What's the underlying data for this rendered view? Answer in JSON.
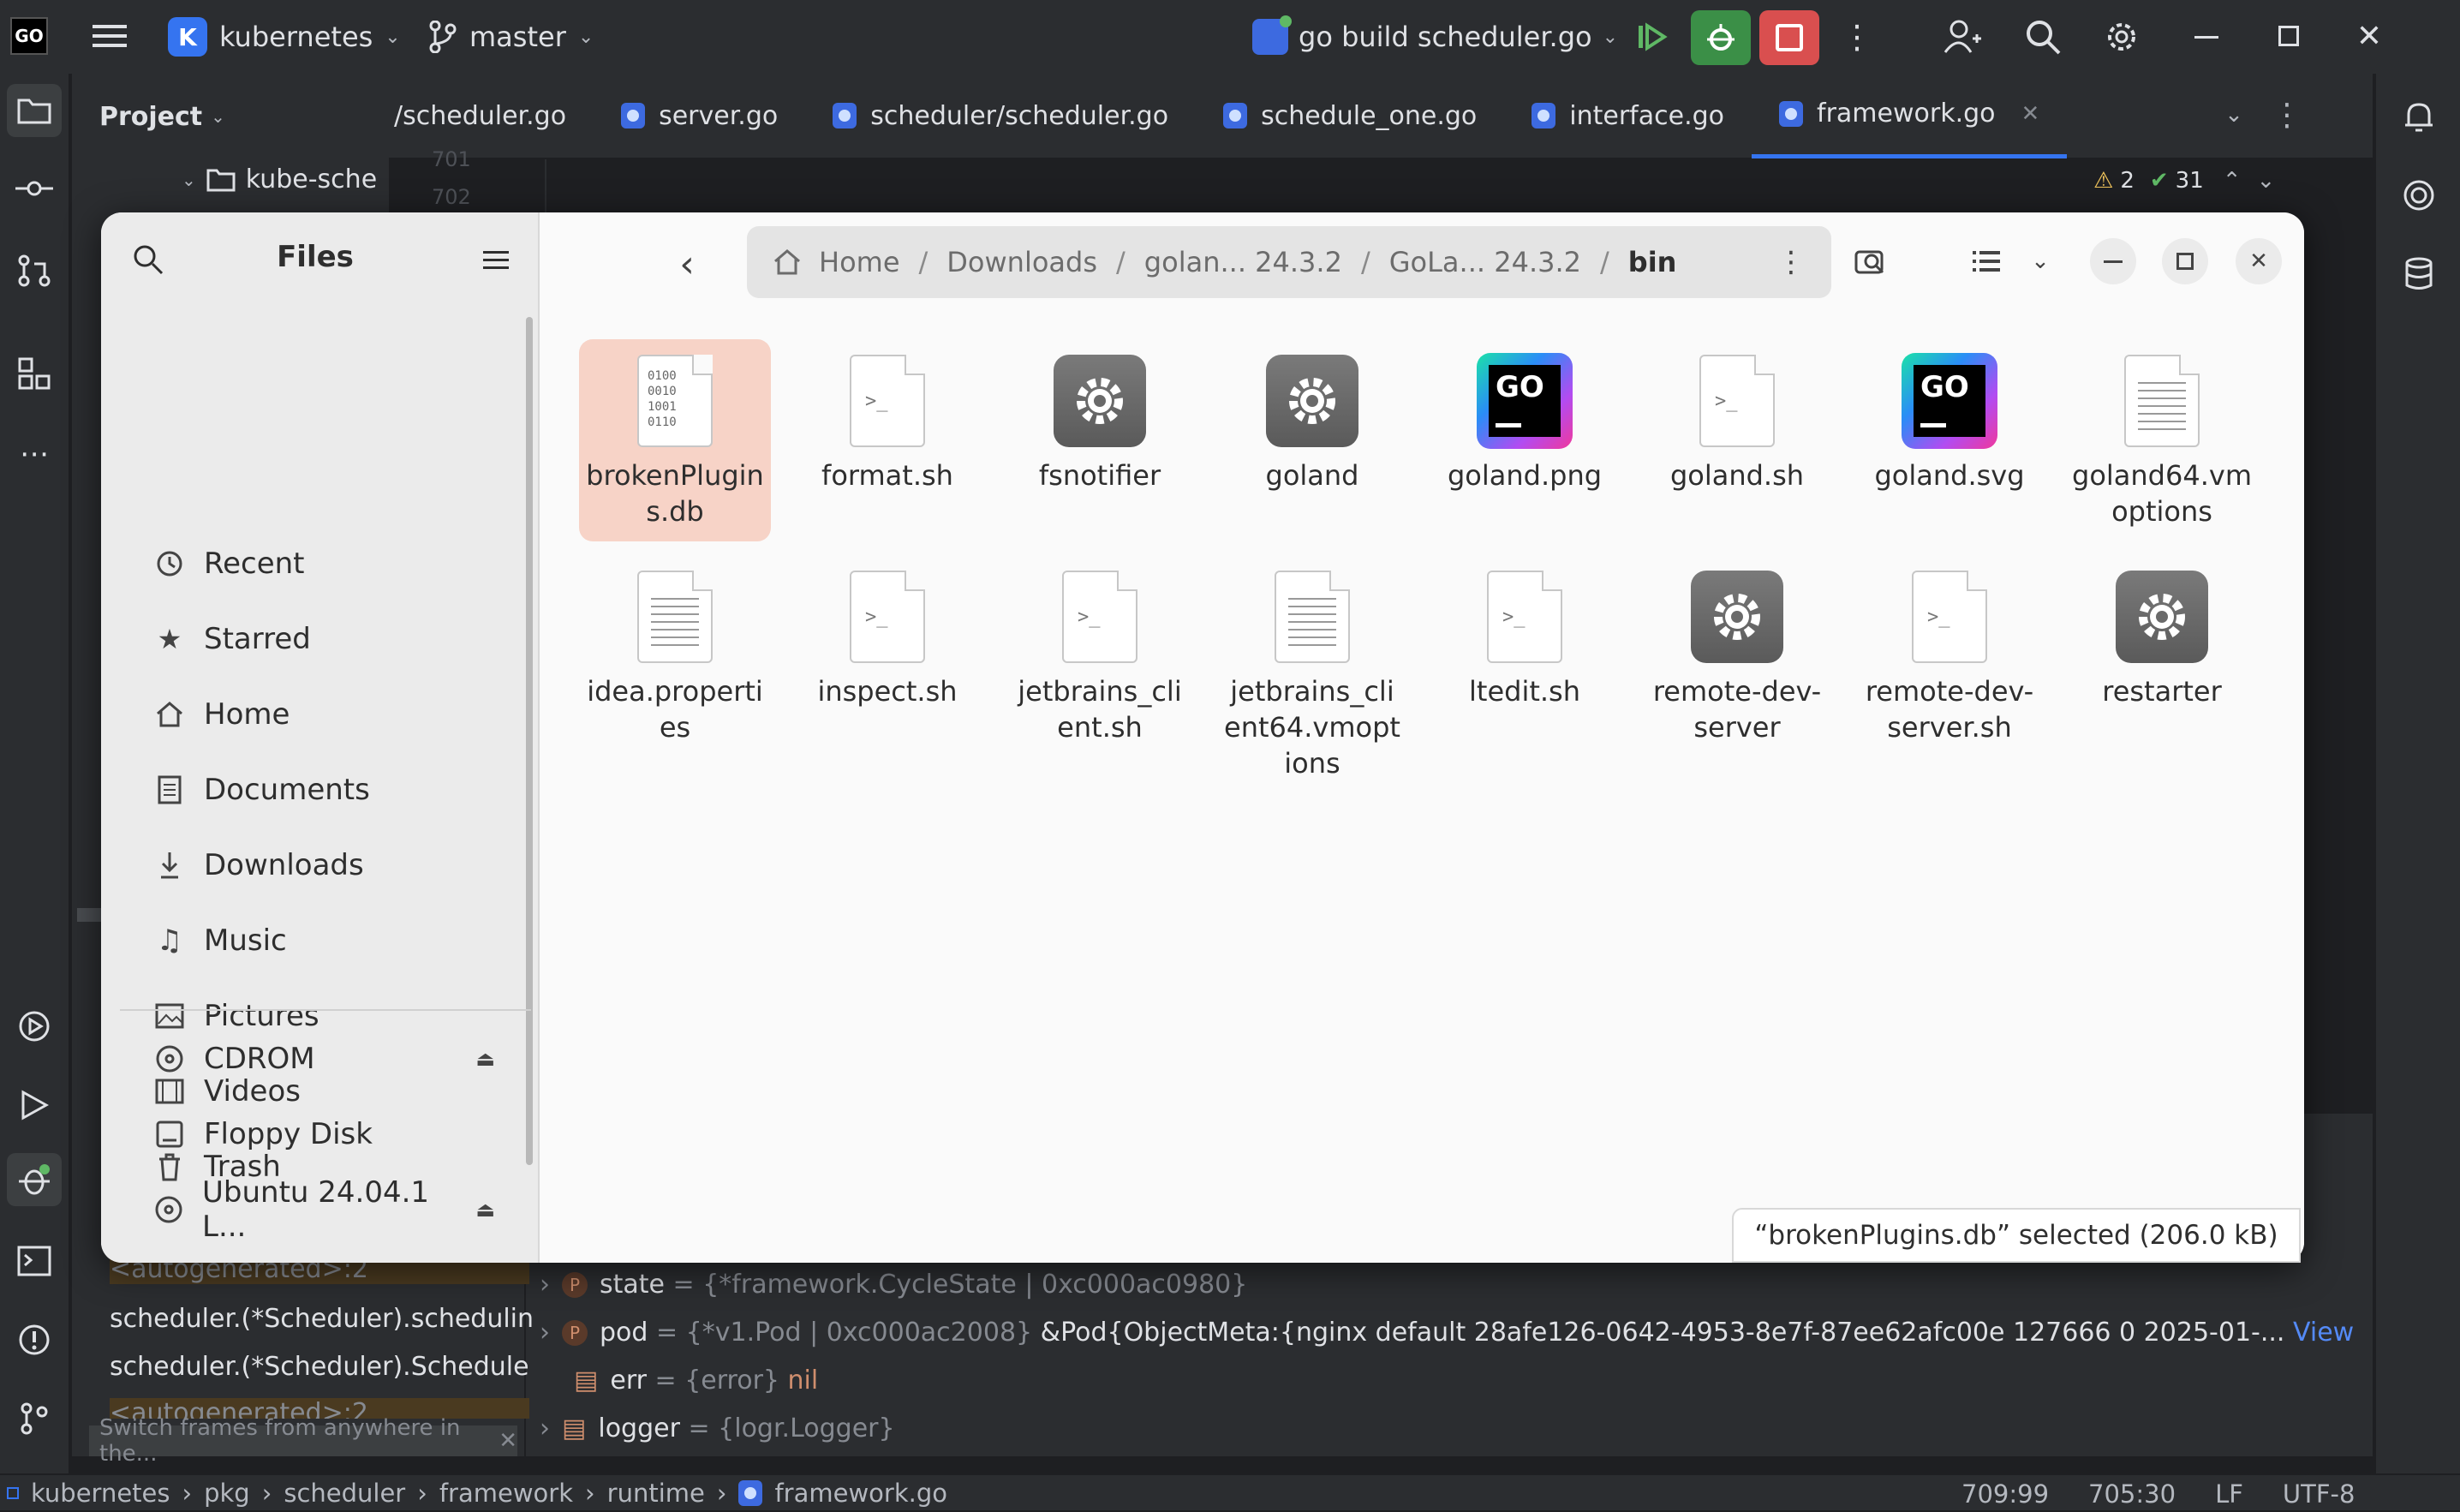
{
  "titlebar": {
    "project": "kubernetes",
    "project_initial": "K",
    "branch": "master",
    "run_config": "go build scheduler.go"
  },
  "project_panel": {
    "title": "Project",
    "tree_item": "kube-sche"
  },
  "editor_tabs": [
    {
      "label": "/scheduler.go"
    },
    {
      "label": "server.go"
    },
    {
      "label": "scheduler/scheduler.go"
    },
    {
      "label": "schedule_one.go"
    },
    {
      "label": "interface.go"
    },
    {
      "label": "framework.go"
    }
  ],
  "editor": {
    "line_701": "701",
    "line_702": "702",
    "warnings": "2",
    "checks": "31"
  },
  "files_dialog": {
    "title": "Files",
    "sidebar": [
      {
        "label": "Recent",
        "icon": "clock-icon"
      },
      {
        "label": "Starred",
        "icon": "star-icon"
      },
      {
        "label": "Home",
        "icon": "home-icon"
      },
      {
        "label": "Documents",
        "icon": "document-icon"
      },
      {
        "label": "Downloads",
        "icon": "download-icon"
      },
      {
        "label": "Music",
        "icon": "music-icon"
      },
      {
        "label": "Pictures",
        "icon": "picture-icon"
      },
      {
        "label": "Videos",
        "icon": "video-icon"
      },
      {
        "label": "Trash",
        "icon": "trash-icon"
      }
    ],
    "devices": [
      {
        "label": "CDROM",
        "icon": "disc-icon"
      },
      {
        "label": "Floppy Disk",
        "icon": "drive-icon"
      },
      {
        "label": "Ubuntu 24.04.1 L...",
        "icon": "disc-icon"
      }
    ],
    "breadcrumb": [
      "Home",
      "Downloads",
      "golan... 24.3.2",
      "GoLa... 24.3.2",
      "bin"
    ],
    "files": [
      {
        "name": "brokenPlugins.db",
        "kind": "binary",
        "selected": true
      },
      {
        "name": "format.sh",
        "kind": "script"
      },
      {
        "name": "fsnotifier",
        "kind": "exec"
      },
      {
        "name": "goland",
        "kind": "exec"
      },
      {
        "name": "goland.png",
        "kind": "logo"
      },
      {
        "name": "goland.sh",
        "kind": "script"
      },
      {
        "name": "goland.svg",
        "kind": "logo"
      },
      {
        "name": "goland64.vmoptions",
        "kind": "text"
      },
      {
        "name": "idea.properties",
        "kind": "text"
      },
      {
        "name": "inspect.sh",
        "kind": "script"
      },
      {
        "name": "jetbrains_client.sh",
        "kind": "script"
      },
      {
        "name": "jetbrains_client64.vmoptions",
        "kind": "text"
      },
      {
        "name": "ltedit.sh",
        "kind": "script"
      },
      {
        "name": "remote-dev-server",
        "kind": "exec"
      },
      {
        "name": "remote-dev-server.sh",
        "kind": "script"
      },
      {
        "name": "restarter",
        "kind": "exec"
      }
    ],
    "status": "“brokenPlugins.db” selected  (206.0 kB)"
  },
  "debug": {
    "frames": [
      "<autogenerated>:2",
      "scheduler.(*Scheduler).schedulin",
      "scheduler.(*Scheduler).Schedule",
      "<autogenerated>:2"
    ],
    "hint": "Switch frames from anywhere in the...",
    "vars": [
      {
        "name": "state",
        "eq": " = ",
        "type": "{*framework.CycleState | 0xc000ac0980}",
        "value": ""
      },
      {
        "name": "pod",
        "eq": " = ",
        "type": "{*v1.Pod | 0xc000ac2008}",
        "value": "&Pod{ObjectMeta:{nginx  default  28afe126-0642-4953-8e7f-87ee62afc00e 127666 0 2025-01-...",
        "link": "View"
      },
      {
        "name": "err",
        "eq": " = ",
        "type": "{error}",
        "value": "nil"
      },
      {
        "name": "logger",
        "eq": " = ",
        "type": "{logr.Logger}",
        "value": ""
      }
    ]
  },
  "statusbar": {
    "path": [
      "kubernetes",
      "pkg",
      "scheduler",
      "framework",
      "runtime",
      "framework.go"
    ],
    "pos1": "709:99",
    "pos2": "705:30",
    "lf": "LF",
    "enc": "UTF-8"
  }
}
